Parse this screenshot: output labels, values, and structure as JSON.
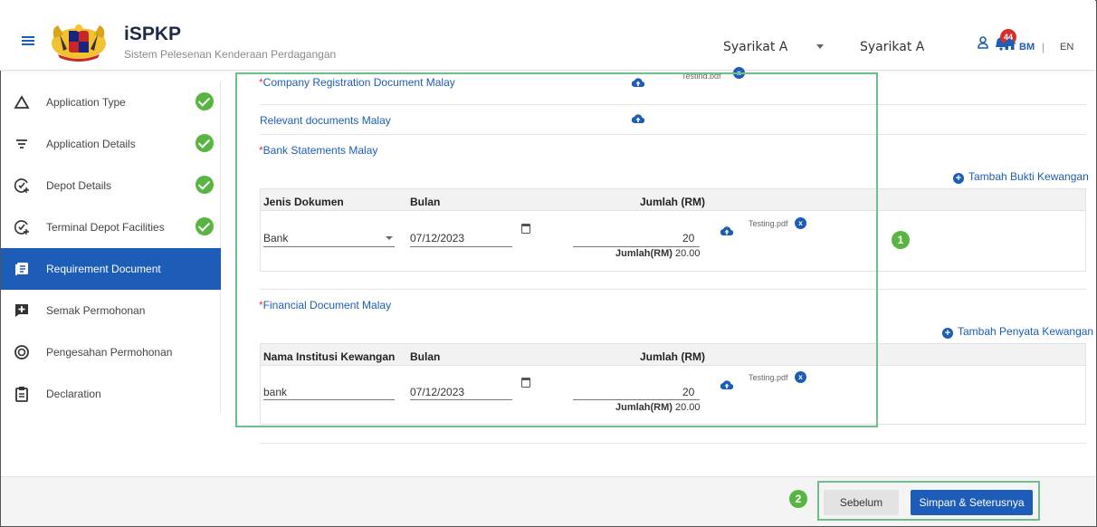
{
  "header": {
    "app_title": "iSPKP",
    "app_subtitle": "Sistem Pelesenan Kenderaan Perdagangan",
    "company_select": "Syarikat A",
    "company_name": "Syarikat A",
    "notification_count": "44",
    "lang_bm": "BM",
    "lang_sep": "|",
    "lang_en": "EN"
  },
  "sidebar": {
    "items": [
      {
        "label": "Application Type",
        "icon": "triangle-icon",
        "done": true
      },
      {
        "label": "Application Details",
        "icon": "filter-icon",
        "done": true
      },
      {
        "label": "Depot Details",
        "icon": "check-add-icon",
        "done": true
      },
      {
        "label": "Terminal Depot Facilities",
        "icon": "check-add-icon",
        "done": true
      },
      {
        "label": "Requirement Document",
        "icon": "document-icon",
        "done": false,
        "active": true
      },
      {
        "label": "Semak Permohonan",
        "icon": "review-icon",
        "done": false
      },
      {
        "label": "Pengesahan Permohonan",
        "icon": "target-icon",
        "done": false
      },
      {
        "label": "Declaration",
        "icon": "clipboard-icon",
        "done": false
      }
    ]
  },
  "main": {
    "company_reg": {
      "required": "*",
      "label": "Company Registration Document Malay",
      "file": "Testing.pdf"
    },
    "relevant_docs": {
      "label": "Relevant documents Malay"
    },
    "bank_statements": {
      "required": "*",
      "label": "Bank Statements Malay",
      "add_link": "Tambah Bukti Kewangan",
      "columns": [
        "Jenis Dokumen",
        "Bulan",
        "Jumlah (RM)"
      ],
      "row": {
        "type": "Bank",
        "month": "07/12/2023",
        "amount": "20",
        "file": "Testing.pdf"
      },
      "total_label": "Jumlah(RM)",
      "total_value": "20.00"
    },
    "financial_docs": {
      "required": "*",
      "label": "Financial Document Malay",
      "add_link": "Tambah Penyata Kewangan",
      "columns": [
        "Nama Institusi Kewangan",
        "Bulan",
        "Jumlah (RM)"
      ],
      "row": {
        "institution": "bank",
        "month": "07/12/2023",
        "amount": "20",
        "file": "Testing.pdf"
      },
      "total_label": "Jumlah(RM)",
      "total_value": "20.00"
    }
  },
  "annotations": {
    "one": "1",
    "two": "2"
  },
  "footer": {
    "prev_label": "Sebelum",
    "next_label": "Simpan & Seterusnya"
  },
  "colors": {
    "primary": "#1d5cb7",
    "success": "#58b541",
    "annotation": "#6cbf8a",
    "required": "#e53935"
  }
}
